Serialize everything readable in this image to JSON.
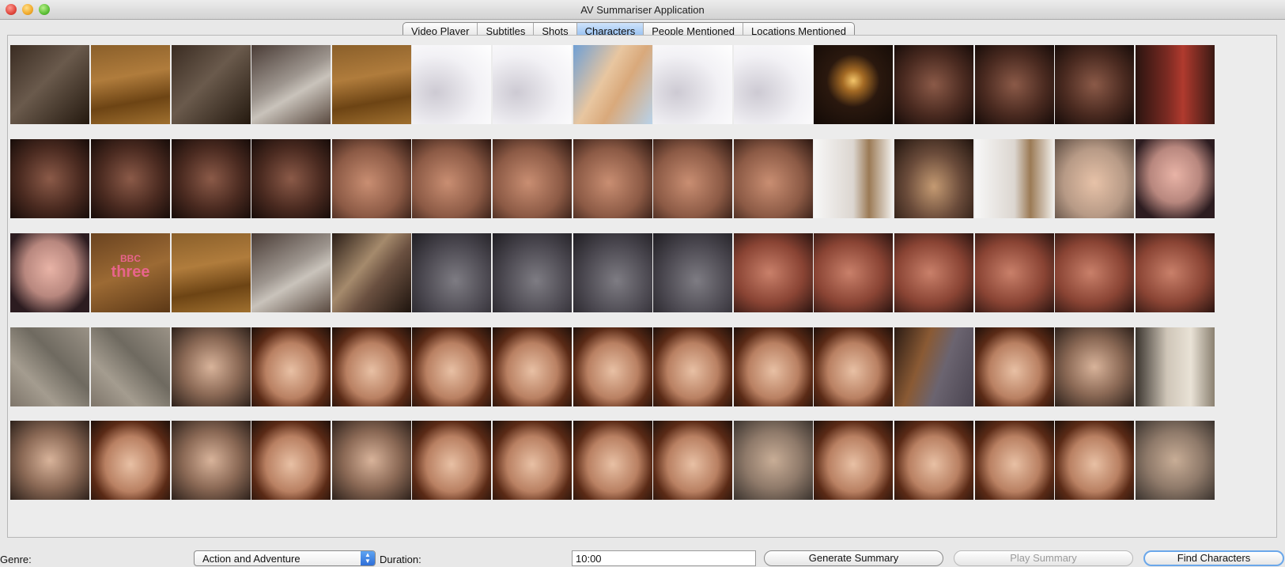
{
  "window": {
    "title": "AV Summariser Application"
  },
  "tabs": [
    {
      "label": "Video Player",
      "active": false
    },
    {
      "label": "Subtitles",
      "active": false
    },
    {
      "label": "Shots",
      "active": false
    },
    {
      "label": "Characters",
      "active": true
    },
    {
      "label": "People Mentioned",
      "active": false
    },
    {
      "label": "Locations Mentioned",
      "active": false
    }
  ],
  "colors": {
    "boxed_outline": "#e25a4e",
    "selected_outline": "#5aa0e8",
    "active_tab": "#8fbcf0"
  },
  "grid": {
    "rows": [
      [
        {
          "kind": "dark-scene",
          "boxed": true
        },
        {
          "kind": "wood",
          "boxed": true
        },
        {
          "kind": "dark-scene",
          "boxed": true
        },
        {
          "kind": "grey-blur",
          "boxed": true
        },
        {
          "kind": "wood",
          "boxed": true
        },
        {
          "kind": "white-cloth",
          "boxed": true
        },
        {
          "kind": "white-cloth",
          "boxed": true
        },
        {
          "kind": "painting",
          "boxed": true
        },
        {
          "kind": "white-cloth",
          "boxed": true
        },
        {
          "kind": "white-cloth",
          "boxed": true
        },
        {
          "kind": "chandelier",
          "boxed": true
        },
        {
          "kind": "face-dark",
          "boxed": false
        },
        {
          "kind": "face-dark",
          "boxed": false
        },
        {
          "kind": "face-dark",
          "boxed": false
        },
        {
          "kind": "red-wall",
          "boxed": true
        }
      ],
      [
        {
          "kind": "face-dark",
          "boxed": false
        },
        {
          "kind": "face-dark",
          "boxed": false
        },
        {
          "kind": "face-dark",
          "boxed": false
        },
        {
          "kind": "face-dark",
          "boxed": false
        },
        {
          "kind": "face-warm",
          "boxed": false
        },
        {
          "kind": "face-warm",
          "boxed": false
        },
        {
          "kind": "face-warm",
          "boxed": false
        },
        {
          "kind": "face-warm",
          "boxed": false
        },
        {
          "kind": "face-warm",
          "boxed": false
        },
        {
          "kind": "face-warm",
          "boxed": false
        },
        {
          "kind": "window-curls",
          "boxed": true
        },
        {
          "kind": "necklace",
          "boxed": false
        },
        {
          "kind": "window-curls",
          "boxed": true
        },
        {
          "kind": "face-pale",
          "boxed": false
        },
        {
          "kind": "hand",
          "boxed": true
        }
      ],
      [
        {
          "kind": "hand",
          "boxed": true
        },
        {
          "kind": "bbc-three",
          "boxed": true,
          "text1": "BBC",
          "text2": "three"
        },
        {
          "kind": "wood",
          "boxed": true
        },
        {
          "kind": "grey-blur",
          "boxed": true
        },
        {
          "kind": "hair",
          "boxed": true
        },
        {
          "kind": "grey-cloth",
          "boxed": true
        },
        {
          "kind": "grey-cloth",
          "boxed": true
        },
        {
          "kind": "grey-cloth",
          "boxed": true
        },
        {
          "kind": "grey-cloth",
          "boxed": true
        },
        {
          "kind": "face-red",
          "boxed": false
        },
        {
          "kind": "face-red",
          "boxed": false
        },
        {
          "kind": "face-red",
          "boxed": false
        },
        {
          "kind": "face-red",
          "boxed": false
        },
        {
          "kind": "face-red",
          "boxed": false
        },
        {
          "kind": "face-red",
          "boxed": false
        }
      ],
      [
        {
          "kind": "noise",
          "boxed": true
        },
        {
          "kind": "noise",
          "boxed": true
        },
        {
          "kind": "face-man",
          "boxed": false
        },
        {
          "kind": "face-woman",
          "boxed": false
        },
        {
          "kind": "face-woman",
          "boxed": false
        },
        {
          "kind": "face-woman",
          "boxed": false
        },
        {
          "kind": "face-woman",
          "boxed": false
        },
        {
          "kind": "face-woman",
          "boxed": false
        },
        {
          "kind": "face-woman",
          "boxed": false
        },
        {
          "kind": "face-woman",
          "boxed": false
        },
        {
          "kind": "face-woman",
          "boxed": false
        },
        {
          "kind": "hair-stone",
          "boxed": true
        },
        {
          "kind": "face-woman",
          "boxed": false
        },
        {
          "kind": "face-man",
          "boxed": false
        },
        {
          "kind": "door",
          "boxed": true
        }
      ],
      [
        {
          "kind": "face-man",
          "boxed": false
        },
        {
          "kind": "face-woman",
          "boxed": false
        },
        {
          "kind": "face-man",
          "boxed": false
        },
        {
          "kind": "face-woman",
          "boxed": false
        },
        {
          "kind": "face-man",
          "boxed": false
        },
        {
          "kind": "face-woman",
          "boxed": false
        },
        {
          "kind": "face-woman",
          "boxed": false,
          "selected": true
        },
        {
          "kind": "face-woman",
          "boxed": false
        },
        {
          "kind": "face-woman",
          "boxed": false
        },
        {
          "kind": "face-man-blur",
          "boxed": false
        },
        {
          "kind": "face-woman",
          "boxed": false
        },
        {
          "kind": "face-woman",
          "boxed": false
        },
        {
          "kind": "face-woman",
          "boxed": false
        },
        {
          "kind": "face-woman",
          "boxed": false
        },
        {
          "kind": "face-man-blur",
          "boxed": false
        }
      ]
    ]
  },
  "controls": {
    "genre_label": "Genre:",
    "genre_value": "Action and Adventure",
    "duration_label": "Duration:",
    "duration_value": "10:00",
    "generate_label": "Generate Summary",
    "play_label": "Play Summary",
    "find_label": "Find Characters"
  }
}
